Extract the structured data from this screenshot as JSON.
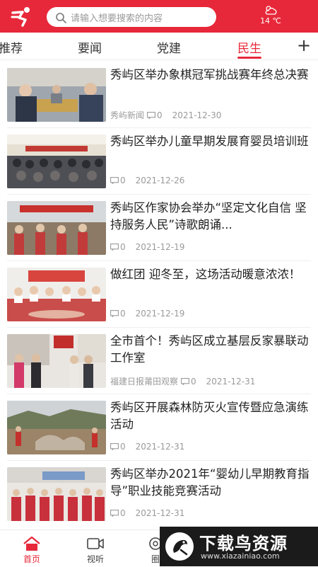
{
  "header": {
    "search_placeholder": "请输入想要搜索的内容",
    "weather_temp": "14 ℃",
    "logo_icon": "runner-logo-icon",
    "accent_color": "#e7283a"
  },
  "tabs": [
    {
      "label": "推荐"
    },
    {
      "label": "要闻"
    },
    {
      "label": "党建"
    },
    {
      "label": "民生",
      "active": true
    }
  ],
  "tab_add_label": "+",
  "news": [
    {
      "title": "秀屿区举办象棋冠军挑战赛年终总决赛",
      "source": "秀屿新闻",
      "comments": "0",
      "date": "2021-12-30"
    },
    {
      "title": "秀屿区举办儿童早期发展育婴员培训班",
      "source": "",
      "comments": "0",
      "date": "2021-12-26"
    },
    {
      "title": "秀屿区作家协会举办“坚定文化自信 坚持服务人民”诗歌朗诵...",
      "source": "",
      "comments": "0",
      "date": "2021-12-19"
    },
    {
      "title": "做红团 迎冬至，这场活动暖意浓浓！",
      "source": "",
      "comments": "0",
      "date": "2021-12-19"
    },
    {
      "title": "全市首个！秀屿区成立基层反家暴联动工作室",
      "source": "福建日报莆田观察",
      "comments": "0",
      "date": "2021-12-31"
    },
    {
      "title": "秀屿区开展森林防灭火宣传暨应急演练活动",
      "source": "",
      "comments": "0",
      "date": "2021-12-31"
    },
    {
      "title": "秀屿区举办2021年“婴幼儿早期教育指导”职业技能竞赛活动",
      "source": "",
      "comments": "0",
      "date": "2021-12-31"
    }
  ],
  "bottom_nav": [
    {
      "label": "首页",
      "icon": "home-icon",
      "active": true
    },
    {
      "label": "视听",
      "icon": "video-icon"
    },
    {
      "label": "圈",
      "icon": "circle-icon"
    }
  ],
  "watermark": {
    "text": "下载鸟资源",
    "url": "www.xiazainiao.com"
  }
}
